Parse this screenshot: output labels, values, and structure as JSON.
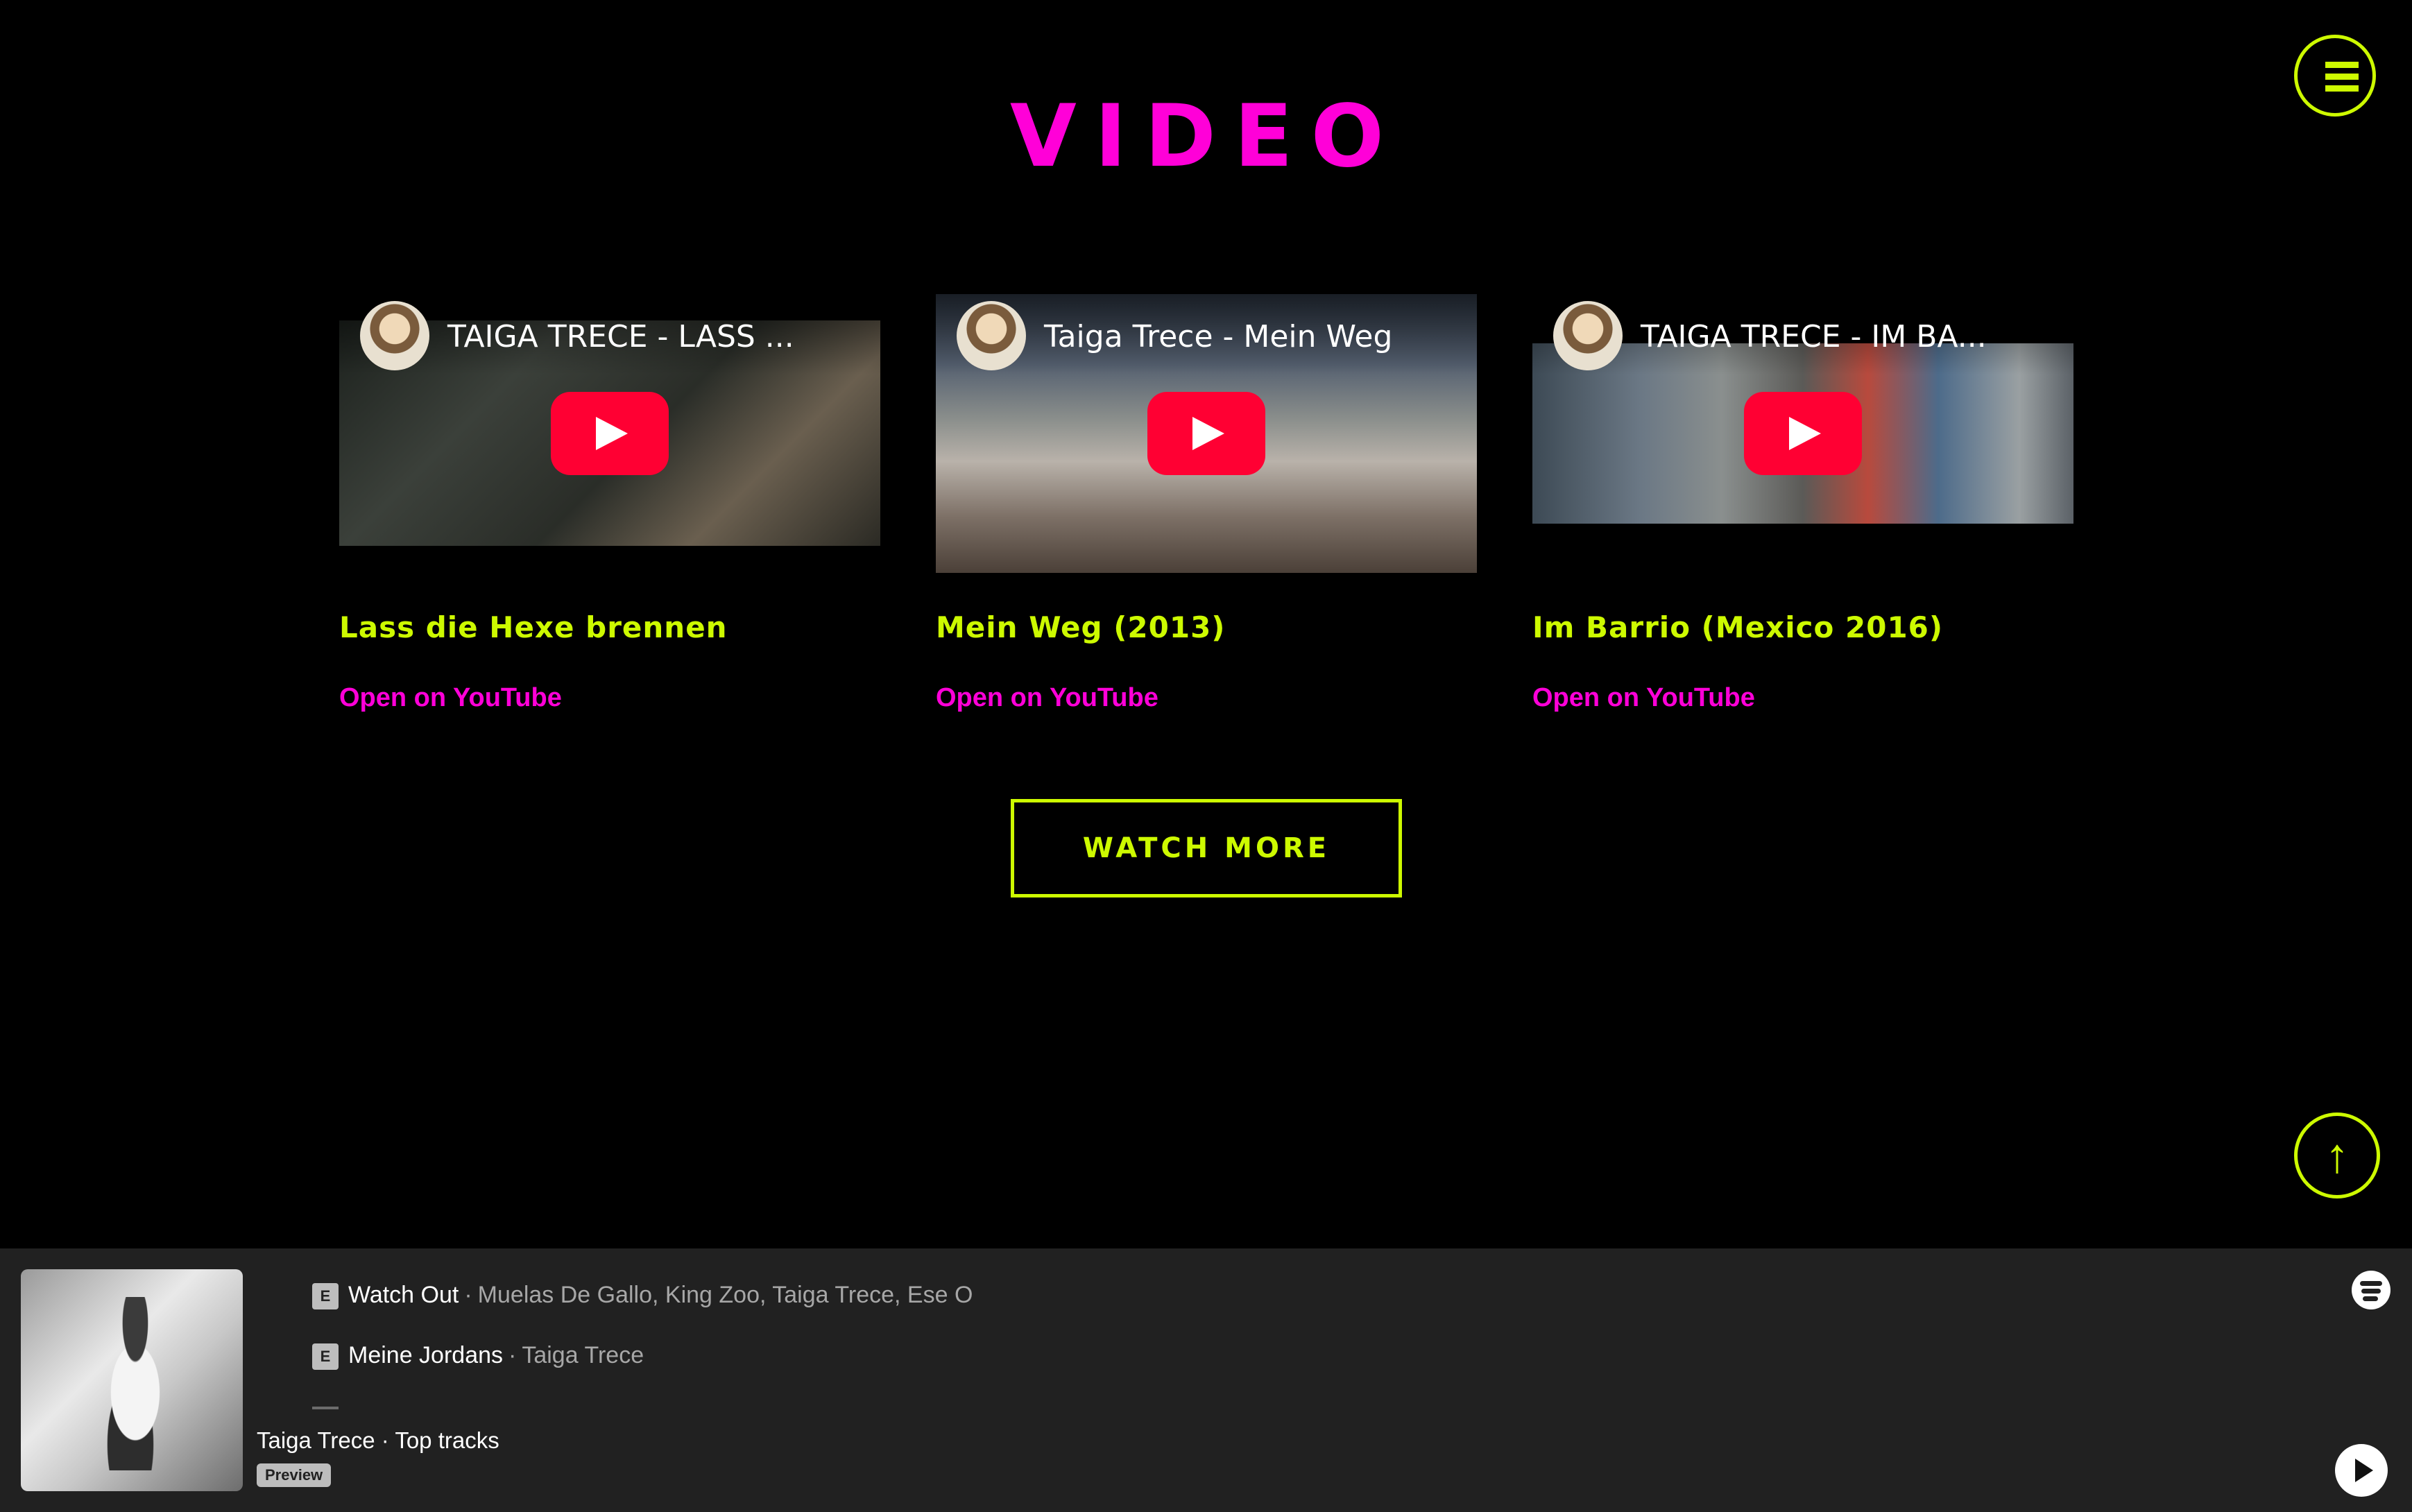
{
  "section": {
    "title": "VIDEO",
    "watch_more_label": "WATCH MORE"
  },
  "nav": {
    "menu_icon": "hamburger-menu-icon",
    "scroll_top_icon": "arrow-up-icon",
    "scroll_top_glyph": "↑"
  },
  "videos": [
    {
      "overlay_title": "TAIGA TRECE - LASS ...",
      "name": "Lass die Hexe brennen",
      "link_label": "Open on YouTube"
    },
    {
      "overlay_title": "Taiga Trece - Mein Weg",
      "name": "Mein Weg (2013)",
      "link_label": "Open on YouTube"
    },
    {
      "overlay_title": "TAIGA TRECE - IM BA...",
      "name": "Im Barrio (Mexico 2016)",
      "link_label": "Open on YouTube"
    }
  ],
  "player": {
    "tracks": [
      {
        "badge": "E",
        "name": "Watch Out",
        "separator": "·",
        "artists": "Muelas De Gallo, King Zoo, Taiga Trece, Ese O"
      },
      {
        "badge": "E",
        "name": "Meine Jordans",
        "separator": "·",
        "artists": "Taiga Trece"
      }
    ],
    "artist_line": "Taiga Trece · Top tracks",
    "preview_label": "Preview",
    "spotify_icon": "spotify-logo-icon",
    "play_icon": "play-icon"
  },
  "colors": {
    "accent_lime": "#cdfa00",
    "accent_magenta": "#ff00d8",
    "youtube_red": "#ff0033"
  }
}
